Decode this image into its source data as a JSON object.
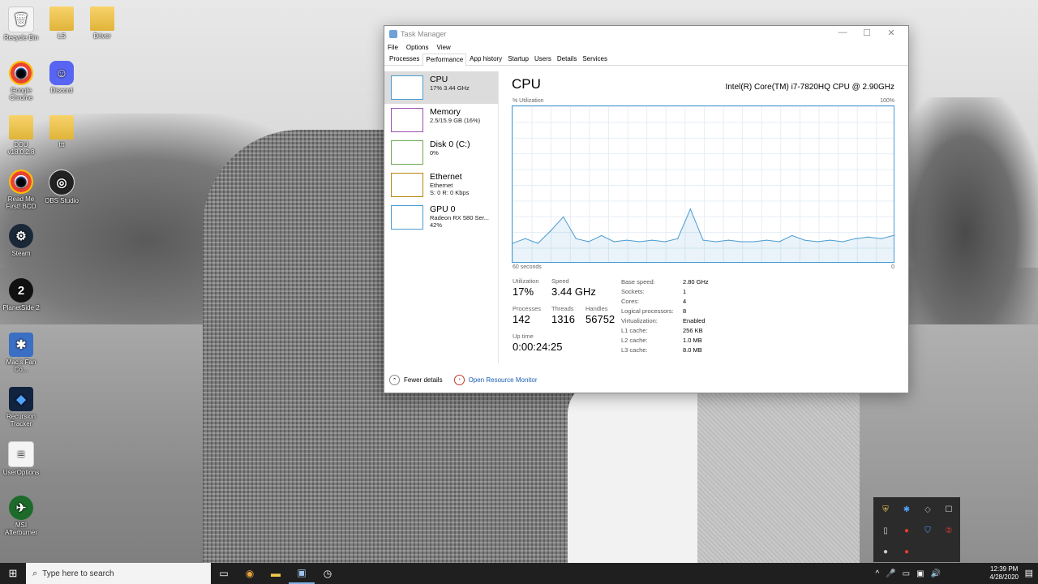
{
  "desktop": {
    "icons": [
      {
        "label": "Recycle Bin",
        "glyph": "🗑",
        "kind": "file"
      },
      {
        "label": "LS",
        "glyph": "",
        "kind": "folder"
      },
      {
        "label": "Driver",
        "glyph": "",
        "kind": "folder"
      },
      {
        "label": "Google Chrome",
        "glyph": "◉",
        "kind": "chrome"
      },
      {
        "label": "Discord",
        "glyph": "☺",
        "kind": "discord"
      },
      {
        "label": "DDU v18.0.2.8",
        "glyph": "",
        "kind": "folder"
      },
      {
        "label": "ttt",
        "glyph": "",
        "kind": "folder"
      },
      {
        "label": "Read Me First! BCD",
        "glyph": "◉",
        "kind": "chrome"
      },
      {
        "label": "OBS Studio",
        "glyph": "◎",
        "kind": "obs"
      },
      {
        "label": "Steam",
        "glyph": "⚙",
        "kind": "steam"
      },
      {
        "label": "PlanetSide 2",
        "glyph": "2",
        "kind": "ps2"
      },
      {
        "label": "Mac's Fan Co...",
        "glyph": "✱",
        "kind": "fan"
      },
      {
        "label": "Recursion Tracker",
        "glyph": "◆",
        "kind": "rec"
      },
      {
        "label": "UserOptions",
        "glyph": "≡",
        "kind": "file"
      },
      {
        "label": "MSI Afterburner",
        "glyph": "✈",
        "kind": "msi"
      }
    ]
  },
  "task_manager": {
    "title": "Task Manager",
    "window_buttons": {
      "minimize": "—",
      "maximize": "☐",
      "close": "✕"
    },
    "menu": [
      "File",
      "Options",
      "View"
    ],
    "tabs": [
      "Processes",
      "Performance",
      "App history",
      "Startup",
      "Users",
      "Details",
      "Services"
    ],
    "active_tab": "Performance",
    "resources": [
      {
        "name": "CPU",
        "sub1": "17% 3.44 GHz",
        "sub2": "",
        "sub3": "",
        "color": "#4a9bd0"
      },
      {
        "name": "Memory",
        "sub1": "2.5/15.9 GB (16%)",
        "sub2": "",
        "sub3": "",
        "color": "#9b4fb3"
      },
      {
        "name": "Disk 0 (C:)",
        "sub1": "0%",
        "sub2": "",
        "sub3": "",
        "color": "#6aa84f"
      },
      {
        "name": "Ethernet",
        "sub1": "Ethernet",
        "sub2": "S: 0 R: 0 Kbps",
        "sub3": "",
        "color": "#b8860b"
      },
      {
        "name": "GPU 0",
        "sub1": "Radeon RX 580 Ser...",
        "sub2": "42%",
        "sub3": "",
        "color": "#4a9bd0"
      }
    ],
    "cpu": {
      "title": "CPU",
      "model": "Intel(R) Core(TM) i7-7820HQ CPU @ 2.90GHz",
      "y_label": "% Utilization",
      "y_max_label": "100%",
      "x_left_label": "60 seconds",
      "x_right_label": "0",
      "stats": {
        "utilization_label": "Utilization",
        "utilization": "17%",
        "speed_label": "Speed",
        "speed": "3.44 GHz",
        "processes_label": "Processes",
        "processes": "142",
        "threads_label": "Threads",
        "threads": "1316",
        "handles_label": "Handles",
        "handles": "56752",
        "uptime_label": "Up time",
        "uptime": "0:00:24:25"
      },
      "details": [
        {
          "k": "Base speed:",
          "v": "2.80 GHz"
        },
        {
          "k": "Sockets:",
          "v": "1"
        },
        {
          "k": "Cores:",
          "v": "4"
        },
        {
          "k": "Logical processors:",
          "v": "8"
        },
        {
          "k": "Virtualization:",
          "v": "Enabled"
        },
        {
          "k": "L1 cache:",
          "v": "256 KB"
        },
        {
          "k": "L2 cache:",
          "v": "1.0 MB"
        },
        {
          "k": "L3 cache:",
          "v": "8.0 MB"
        }
      ]
    },
    "footer": {
      "fewer_details": "Fewer details",
      "resource_monitor": "Open Resource Monitor"
    }
  },
  "chart_data": {
    "type": "area",
    "x": [
      60,
      58,
      56,
      54,
      52,
      50,
      48,
      46,
      44,
      42,
      40,
      38,
      36,
      34,
      32,
      30,
      28,
      26,
      24,
      22,
      20,
      18,
      16,
      14,
      12,
      10,
      8,
      6,
      4,
      2,
      0
    ],
    "values": [
      12,
      15,
      12,
      20,
      29,
      15,
      13,
      17,
      13,
      14,
      13,
      14,
      13,
      15,
      34,
      14,
      13,
      14,
      13,
      13,
      14,
      13,
      17,
      14,
      13,
      14,
      13,
      15,
      16,
      15,
      17
    ],
    "ylim": [
      0,
      100
    ],
    "xlim": [
      60,
      0
    ],
    "grid": true,
    "color": "#4a9bd0"
  },
  "tray_popup": [
    "⛨",
    "✱",
    "◇",
    "☐",
    "▯",
    "●",
    "⛉",
    "②",
    "●",
    "●"
  ],
  "taskbar": {
    "search_placeholder": "Type here to search",
    "apps": [
      "▭",
      "◉",
      "▬",
      "▣",
      "◷"
    ],
    "sys": [
      "^",
      "🎤",
      "▭",
      "▣",
      "🔊"
    ],
    "time": "12:39 PM",
    "date": "4/28/2020",
    "notif": "▤"
  }
}
